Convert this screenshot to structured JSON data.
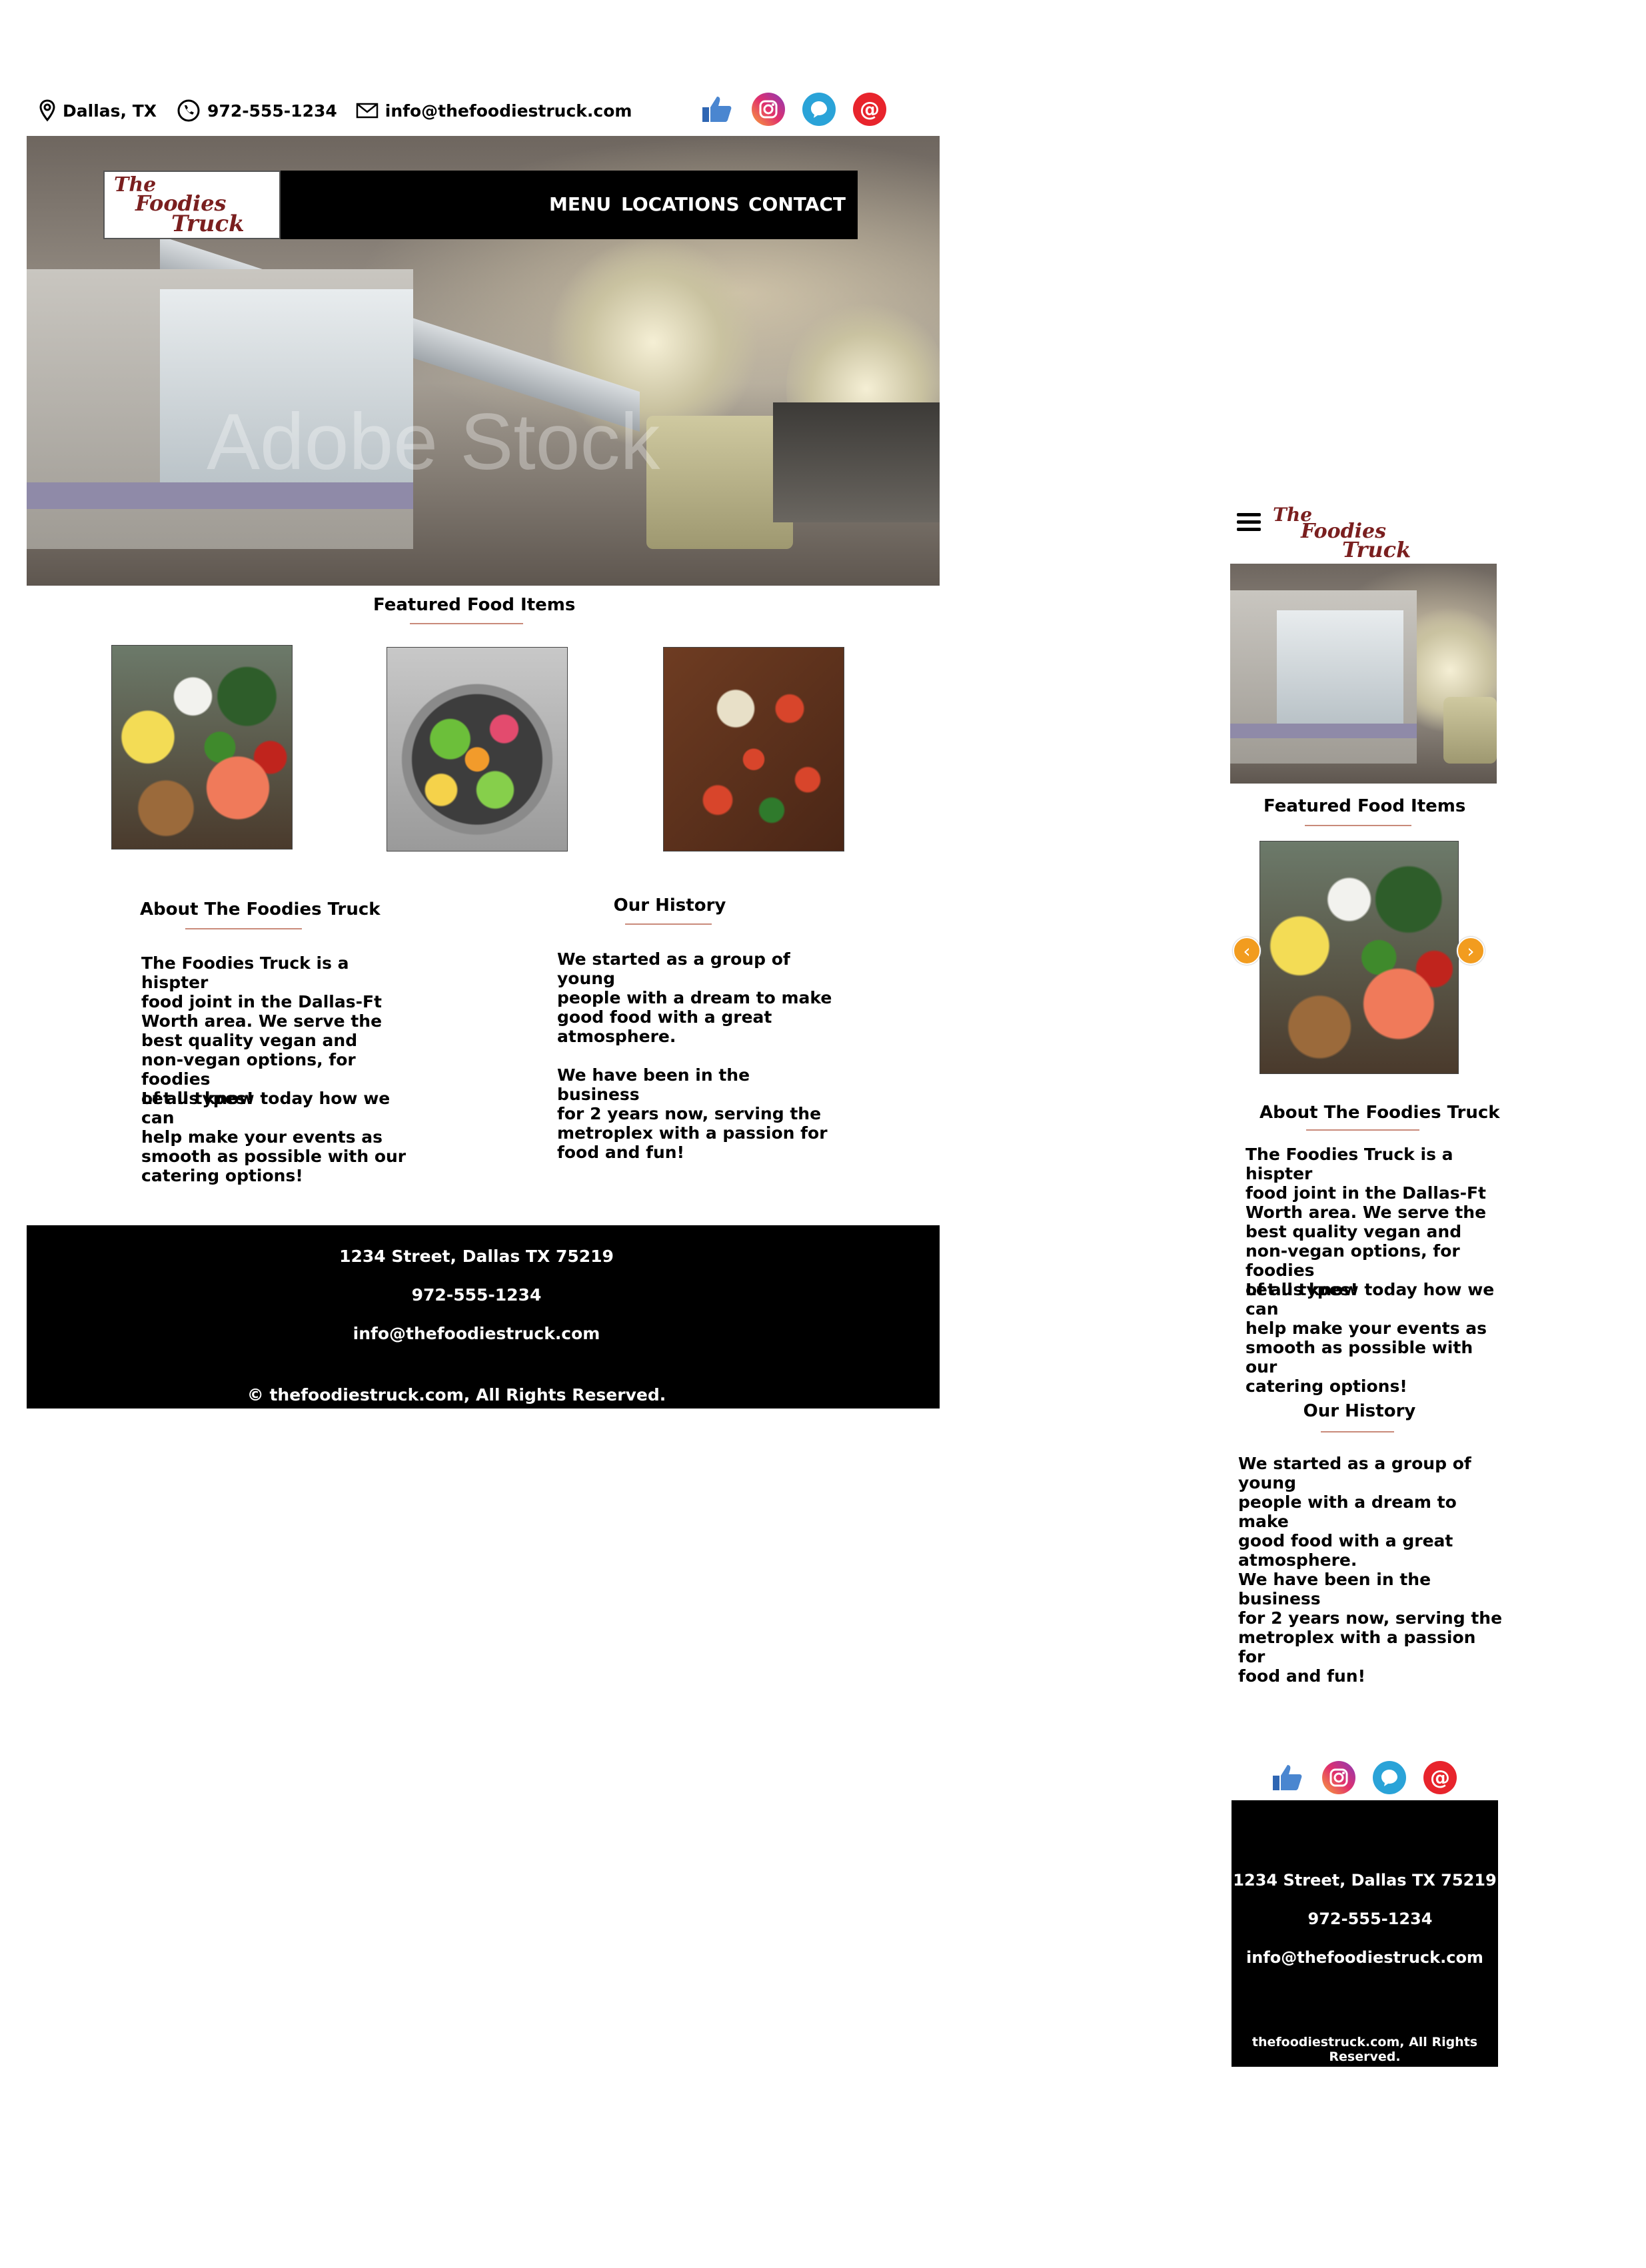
{
  "desktop": {
    "topbar": {
      "location": "Dallas, TX",
      "phone": "972-555-1234",
      "email": "info@thefoodiestruck.com"
    },
    "social_icons": [
      "thumbs-up-icon",
      "instagram-icon",
      "chat-bubble-icon",
      "at-sign-icon"
    ],
    "logo": {
      "line1": "The",
      "line2": "Foodies",
      "line3": "Truck"
    },
    "nav": {
      "menu": "MENU",
      "locations": "LOCATIONS",
      "contact": "CONTACT"
    },
    "hero_watermark": "Adobe Stock",
    "featured_title": "Featured Food Items",
    "about": {
      "title": "About The Foodies Truck",
      "text1": "The Foodies Truck is a hispter\nfood joint in the Dallas-Ft\nWorth area. We serve the\nbest quality vegan and\nnon-vegan options, for foodies\nof all types!",
      "text2": "Let us know today how we can\nhelp make your events as\nsmooth as possible with our\ncatering options!"
    },
    "history": {
      "title": "Our History",
      "text1": "We started as a group of young\npeople with a dream to make\ngood food with a great\natmosphere.",
      "text2": "We have been in the business\nfor 2 years now, serving the\nmetroplex with a passion for\nfood and fun!"
    },
    "footer": {
      "address": "1234 Street, Dallas TX 75219",
      "phone": "972-555-1234",
      "email": "info@thefoodiestruck.com",
      "copyright": "© thefoodiestruck.com, All Rights Reserved."
    }
  },
  "mobile": {
    "logo": {
      "line1": "The",
      "line2": "Foodies",
      "line3": "Truck"
    },
    "featured_title": "Featured Food Items",
    "carousel": {
      "prev": "‹",
      "next": "›"
    },
    "about": {
      "title": "About The Foodies Truck",
      "text1": "The Foodies Truck is a hispter\nfood joint in the Dallas-Ft\nWorth area. We serve the\nbest quality vegan and\nnon-vegan options, for foodies\nof all types!",
      "text2": "Let us know today how we can\nhelp make your events as\nsmooth as possible with our\ncatering options!"
    },
    "history": {
      "title": "Our History",
      "text1": "We started as a group of young\npeople with a dream to make\ngood food with a great\natmosphere.",
      "text2": "We have been in the business\nfor 2 years now, serving the\nmetroplex with a passion for\nfood and fun!"
    },
    "footer": {
      "address": "1234 Street, Dallas TX 75219",
      "phone": "972-555-1234",
      "email": "info@thefoodiestruck.com",
      "copyright": "thefoodiestruck.com, All Rights Reserved."
    }
  },
  "colors": {
    "logo": "#7a1f1f",
    "nav_bg": "#000000",
    "footer_bg": "#000000",
    "underline": "#c98a7a",
    "carousel_arrow": "#f29c1f"
  }
}
